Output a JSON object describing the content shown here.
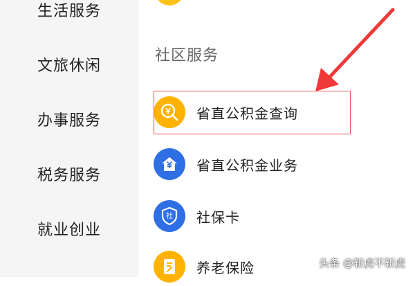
{
  "sidebar": {
    "items": [
      {
        "label": "生活服务"
      },
      {
        "label": "文旅休闲"
      },
      {
        "label": "办事服务"
      },
      {
        "label": "税务服务"
      },
      {
        "label": "就业创业"
      }
    ]
  },
  "main": {
    "section_title": "社区服务",
    "services": [
      {
        "label": "省直公积金查询",
        "icon": "fund-query-icon",
        "color": "#ffb300"
      },
      {
        "label": "省直公积金业务",
        "icon": "fund-business-icon",
        "color": "#2f6fe6"
      },
      {
        "label": "社保卡",
        "icon": "social-security-card-icon",
        "color": "#2f6fe6",
        "icon_text": "社"
      },
      {
        "label": "养老保险",
        "icon": "pension-insurance-icon",
        "color": "#ffb300"
      }
    ]
  },
  "colors": {
    "highlight": "#f04a4a",
    "yellow": "#ffb300",
    "blue": "#2f6fe6"
  },
  "watermark": "头条 @斩虎不斩虎"
}
